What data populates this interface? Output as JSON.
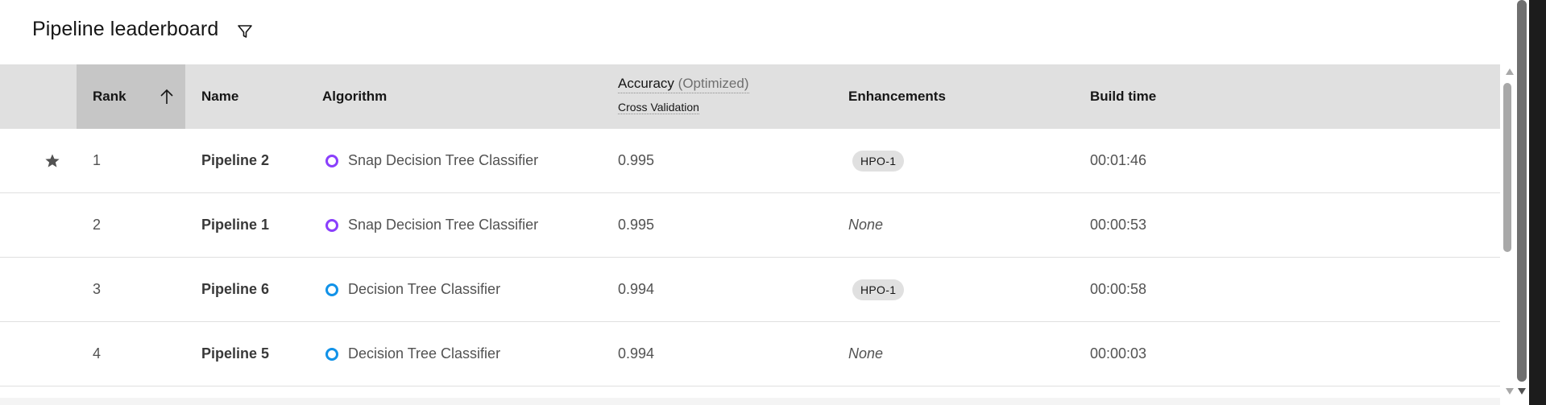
{
  "header": {
    "title": "Pipeline leaderboard",
    "filter_icon": "filter-icon"
  },
  "table": {
    "columns": {
      "rank": "Rank",
      "name": "Name",
      "algorithm": "Algorithm",
      "accuracy_label": "Accuracy",
      "accuracy_optimized": "(Optimized)",
      "accuracy_sub": "Cross Validation",
      "enhancements": "Enhancements",
      "build_time": "Build time"
    },
    "sort": {
      "column": "rank",
      "direction": "ascending",
      "icon": "arrow-up-icon"
    },
    "rows": [
      {
        "starred": true,
        "rank": "1",
        "name": "Pipeline 2",
        "algorithm": "Snap Decision Tree Classifier",
        "algo_color": "#8a3ffc",
        "accuracy": "0.995",
        "enhancement": "HPO-1",
        "build_time": "00:01:46"
      },
      {
        "starred": false,
        "rank": "2",
        "name": "Pipeline 1",
        "algorithm": "Snap Decision Tree Classifier",
        "algo_color": "#8a3ffc",
        "accuracy": "0.995",
        "enhancement": "None",
        "build_time": "00:00:53"
      },
      {
        "starred": false,
        "rank": "3",
        "name": "Pipeline 6",
        "algorithm": "Decision Tree Classifier",
        "algo_color": "#1192e8",
        "accuracy": "0.994",
        "enhancement": "HPO-1",
        "build_time": "00:00:58"
      },
      {
        "starred": false,
        "rank": "4",
        "name": "Pipeline 5",
        "algorithm": "Decision Tree Classifier",
        "algo_color": "#1192e8",
        "accuracy": "0.994",
        "enhancement": "None",
        "build_time": "00:00:03"
      }
    ]
  },
  "icons": {
    "star": "star-icon",
    "algorithm_marker": "circle-icon"
  },
  "colors": {
    "header_bg": "#e0e0e0",
    "sorted_header_bg": "#c6c6c6",
    "tag_bg": "#e0e0e0"
  }
}
